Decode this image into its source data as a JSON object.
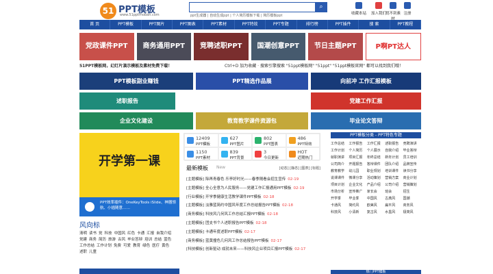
{
  "header": {
    "logo_mark": "51",
    "logo_text": "PPT模板",
    "logo_sub": "www.51pptmoban.com",
    "hot_searches": "ppt生成器 | 自动生成ppt | 个人简历模板下载 | 简历模板ppt",
    "tools": [
      {
        "label": "收藏本站",
        "icon": "star-icon"
      },
      {
        "label": "加入我们",
        "icon": "join-icon"
      },
      {
        "label": "找不到素材",
        "icon": "request-icon"
      },
      {
        "label": "注册",
        "icon": "register-icon"
      }
    ]
  },
  "nav": [
    "首 页",
    "PPT模板",
    "PPT图片",
    "PPT图表",
    "PPT素材",
    "PPT特效",
    "PPT专题",
    "排行榜",
    "PPT插件",
    "搜 索",
    "PPT教程"
  ],
  "banners": [
    "党政课件PPT",
    "商务通用PPT",
    "竞聘述职PPT",
    "国潮创意PPT",
    "节日主题PPT",
    "P啊PT达人"
  ],
  "notice": {
    "left": "51PPT模板网，幻灯片演示模板及素材免费下载！",
    "right": "Ctrl+D 加为收藏 · 搜索引擎搜索 \"51ppt模板网\" \"51ppt\" \"51ppt模板官网\" 都可以找到我们哦！"
  },
  "tiles": [
    "PPT模板副业赚钱",
    "PPT精选作品展",
    "向前冲 工作汇报模板",
    "述职报告",
    "党建工作汇报",
    "企业文化建设",
    "教育教学课件资源包",
    "毕业论文答辩"
  ],
  "hero": {
    "text": "开学第一课"
  },
  "plugin": {
    "text": "PPT效率插件：OneKeyTools iSlide、神器领航、小插随意……"
  },
  "tags": {
    "title": "风向标",
    "items": [
      "清明",
      "读书",
      "党",
      "科技",
      "中国风",
      "红色",
      "卡通",
      "汇报",
      "自我介绍",
      "党建",
      "商务",
      "简历",
      "旅游",
      "古风",
      "毕业答辩",
      "培训",
      "总结",
      "蓝色",
      "工作总结",
      "工作计划",
      "免费",
      "可爱",
      "教育",
      "绿色",
      "医疗",
      "黄色",
      "述职",
      "儿童"
    ]
  },
  "stats": [
    {
      "num": "12409",
      "label": "PPT模板",
      "icon": "template-icon",
      "color": "#3a8ee6"
    },
    {
      "num": "627",
      "label": "PPT图片",
      "icon": "image-icon",
      "color": "#33b3f0"
    },
    {
      "num": "802",
      "label": "PPT图表",
      "icon": "chart-icon",
      "color": "#2bb36d"
    },
    {
      "num": "486",
      "label": "PPT特效",
      "icon": "effect-icon",
      "color": "#f0a020"
    },
    {
      "num": "1150",
      "label": "PPT素材",
      "icon": "material-icon",
      "color": "#3a8ee6"
    },
    {
      "num": "839",
      "label": "PPT背景",
      "icon": "background-icon",
      "color": "#33b3f0"
    },
    {
      "num": "3",
      "label": "今日更新",
      "icon": "update-icon",
      "color": "#f04040"
    },
    {
      "num": "HOT",
      "label": "近期热门",
      "icon": "hot-icon",
      "color": "#f08a1c"
    }
  ],
  "latest": {
    "title": "最新模板",
    "subtitle": "New",
    "links": "[动态] [静态] [图表] [标题]",
    "items": [
      {
        "cat": "[主题模板]",
        "title": "除再青春色 乐亭好时光——春季随看会招生宣传",
        "date": "02-19"
      },
      {
        "cat": "[主题模板]",
        "title": "全心全意为人民服务——党建工作汇报通用PPT模板",
        "date": "02-19"
      },
      {
        "cat": "[行业模板]",
        "title": "开学季健康生活教学课件PPT模板",
        "date": "02-18"
      },
      {
        "cat": "[主题模板]",
        "title": "淡雅蓝简约中国风年度工作总结报告PPT模板",
        "date": "02-18"
      },
      {
        "cat": "[商务模板]",
        "title": "科技风几何风工作总结汇报PPT模板",
        "date": "02-18"
      },
      {
        "cat": "[主题模板]",
        "title": "团支书个人述职报告PPT模板",
        "date": "02-18"
      },
      {
        "cat": "[主题模板]",
        "title": "卡通年度述职PPT模板",
        "date": "02-17"
      },
      {
        "cat": "[商务模板]",
        "title": "蓝黄撞色几何风工作总结报告PPT模板",
        "date": "02-17"
      },
      {
        "cat": "[科技模板]",
        "title": "创新驱动 成就未来——科技风企业项目汇报PPT模板",
        "date": "02-17"
      }
    ]
  },
  "sidebar": {
    "title": "PPT模板分类 - PPT特色专题",
    "bottom_title": "热门PPT模板",
    "cats": [
      "工作总结",
      "工作报告",
      "工作汇报",
      "述职报告",
      "竞聘演讲",
      "工作计划",
      "个人简历",
      "个人展示",
      "自我介绍",
      "毕业答辩",
      "就职演讲",
      "项目汇报",
      "年终总结",
      "新年计划",
      "员工培训",
      "公司简介",
      "开题报告",
      "答辩课件",
      "团队介绍",
      "品牌宣传",
      "教育教学",
      "幼儿园",
      "职业规划",
      "培训课件",
      "读书分享",
      "说课课件",
      "微课分享",
      "活动策划",
      "营销方案",
      "商业计划",
      "项目计划",
      "企业文化",
      "产品介绍",
      "公司介绍",
      "营销策划",
      "市场分析",
      "宣传推广",
      "家长会",
      "班会",
      "招生",
      "开学季",
      "毕业季",
      "中国风",
      "古典风",
      "国潮",
      "卡通风",
      "简约风",
      "欧美风",
      "扁平风",
      "商务风",
      "科技风",
      "小清新",
      "复古风",
      "水墨风",
      "极简风"
    ]
  }
}
